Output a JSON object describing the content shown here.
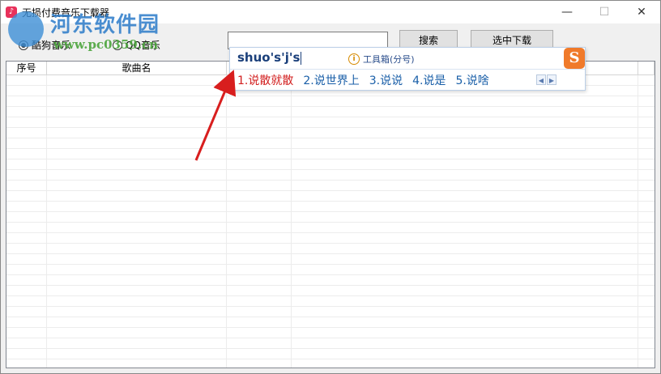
{
  "window": {
    "title": "无损付费音乐下载器",
    "controls": {
      "minimize": "—",
      "maximize": "☐",
      "close": "✕"
    }
  },
  "toolbar": {
    "source_options": [
      {
        "label": "酷狗音乐",
        "selected": true
      },
      {
        "label": "QQ音乐",
        "selected": false
      }
    ],
    "search_value": "",
    "search_button": "搜索",
    "download_button": "选中下载"
  },
  "table": {
    "columns": [
      "序号",
      "歌曲名",
      "",
      ""
    ],
    "rows": []
  },
  "ime": {
    "composition": "shuo's'j's",
    "toolbox_label": "工具箱(分号)",
    "candidates": [
      "1.说散就散",
      "2.说世界上",
      "3.说说",
      "4.说是",
      "5.说啥"
    ],
    "logo": "S"
  },
  "watermark": {
    "text": "河东软件园",
    "url": "www.pc0359.cn"
  },
  "colors": {
    "accent_red": "#d21f1f",
    "candidate_blue": "#1a5fa8",
    "arrow": "#d81e1e"
  }
}
